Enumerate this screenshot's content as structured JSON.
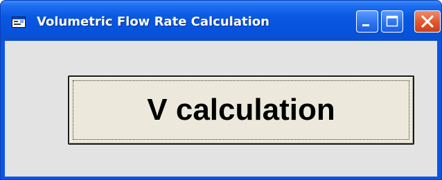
{
  "window": {
    "title": "Volumetric Flow Rate Calculation",
    "icon": "form-app-icon",
    "controls": {
      "minimize_icon": "minimize-icon",
      "maximize_icon": "maximize-icon",
      "close_icon": "close-icon"
    },
    "colors": {
      "titlebar": "#0653dd",
      "close_button": "#e2562a",
      "client_background": "#e3e3e3",
      "button_face": "#ece9dc"
    }
  },
  "main": {
    "calc_button_label": "V calculation"
  }
}
